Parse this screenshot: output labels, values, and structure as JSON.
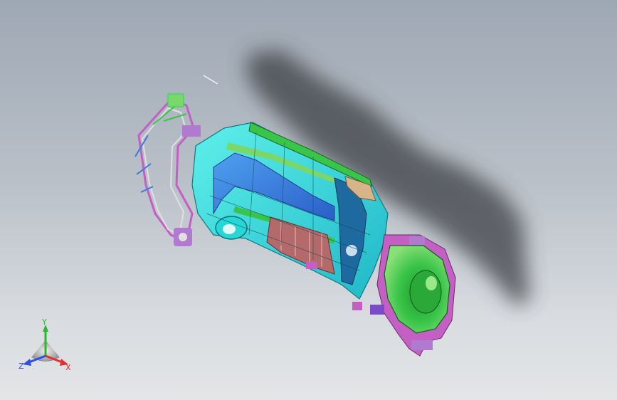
{
  "viewport": {
    "background_top": "#9ea8b4",
    "background_bottom": "#e3e5e7"
  },
  "model": {
    "shadow_color": "#3c3f44",
    "part_colors": [
      "#27d6d6",
      "#1ea6e0",
      "#3a7ad8",
      "#39c44a",
      "#7ad86a",
      "#c45fc4",
      "#b07ad0",
      "#b46a6a",
      "#e0e0e0",
      "#d8b48a"
    ]
  },
  "triad": {
    "x_label": "X",
    "y_label": "Y",
    "z_label": "Z",
    "x_color": "#e03030",
    "y_color": "#2fb52f",
    "z_color": "#2f4fe0"
  }
}
